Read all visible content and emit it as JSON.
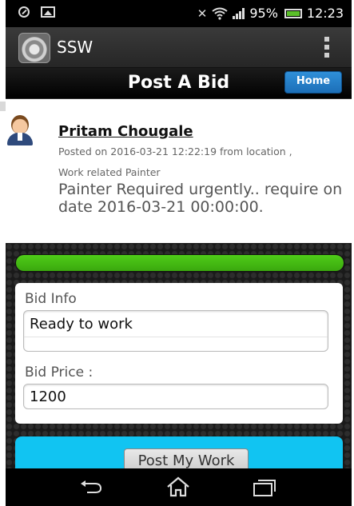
{
  "status_bar": {
    "battery": "95%",
    "time": "12:23"
  },
  "app_bar": {
    "title": "SSW",
    "icon": "gear-app-icon",
    "menu_icon": "overflow-menu-icon"
  },
  "header": {
    "title": "Post A Bid",
    "home_label": "Home"
  },
  "post": {
    "name": "Pritam Chougale",
    "posted_line": "Posted on 2016-03-21 12:22:19 from location ,",
    "work_line": "Work related Painter",
    "body": "Painter Required urgently.. require on date 2016-03-21 00:00:00."
  },
  "progress": {
    "value_percent": 100,
    "color": "#3aa80e"
  },
  "form": {
    "bid_info_label": "Bid Info",
    "bid_info_value": "Ready to work",
    "bid_price_label": "Bid Price :",
    "bid_price_value": "1200",
    "submit_label": "Post My Work"
  },
  "colors": {
    "accent_cyan": "#11c4f2",
    "home_button": "#1c6fb8"
  },
  "nav": {
    "back_icon": "back-arrow-icon",
    "home_icon": "home-icon",
    "recent_icon": "recent-apps-icon"
  }
}
